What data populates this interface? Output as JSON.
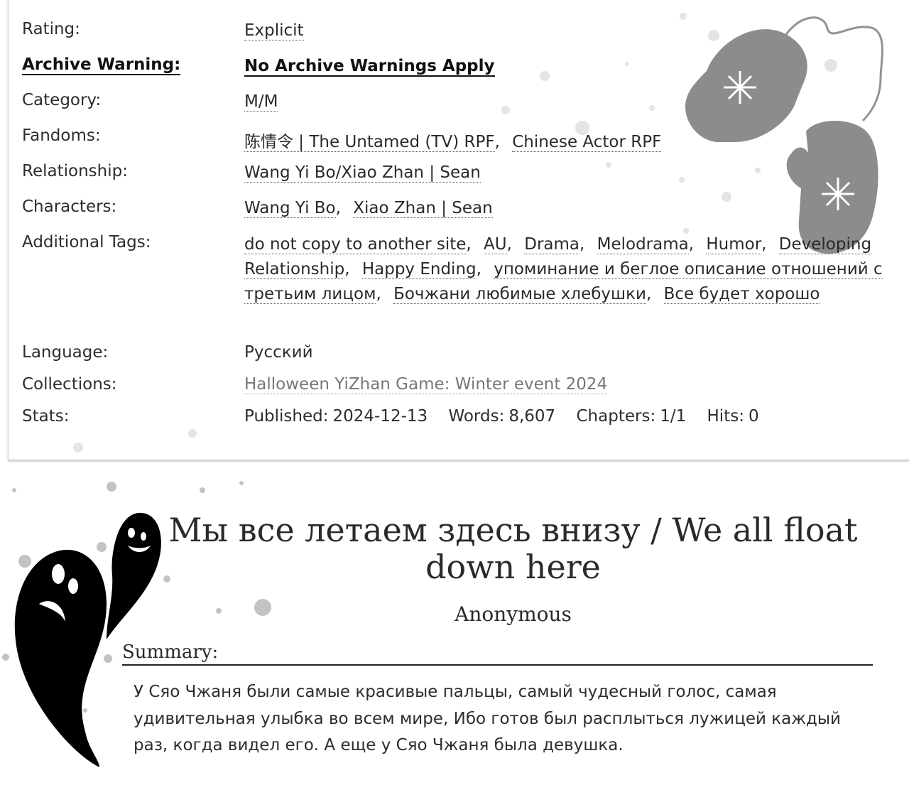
{
  "meta": {
    "rating": {
      "label": "Rating:",
      "value": "Explicit"
    },
    "warning": {
      "label": "Archive Warning:",
      "value": "No Archive Warnings Apply"
    },
    "category": {
      "label": "Category:",
      "value": "M/M"
    },
    "fandoms": {
      "label": "Fandoms:",
      "items": [
        "陈情令 | The Untamed (TV) RPF",
        "Chinese Actor RPF"
      ]
    },
    "relationship": {
      "label": "Relationship:",
      "value": "Wang Yi Bo/Xiao Zhan | Sean"
    },
    "characters": {
      "label": "Characters:",
      "items": [
        "Wang Yi Bo",
        "Xiao Zhan | Sean"
      ]
    },
    "additional_tags": {
      "label": "Additional Tags:",
      "items": [
        "do not copy to another site",
        "AU",
        "Drama",
        "Melodrama",
        "Humor",
        "Developing Relationship",
        "Happy Ending",
        "упоминание и беглое описание отношений с третьим лицом",
        "Бочжани любимые хлебушки",
        "Все будет хорошо"
      ]
    },
    "language": {
      "label": "Language:",
      "value": "Русский"
    },
    "collections": {
      "label": "Collections:",
      "value": "Halloween YiZhan Game: Winter event 2024"
    },
    "stats": {
      "label": "Stats:",
      "published_label": "Published:",
      "published": "2024-12-13",
      "words_label": "Words:",
      "words": "8,607",
      "chapters_label": "Chapters:",
      "chapters": "1/1",
      "hits_label": "Hits:",
      "hits": "0"
    }
  },
  "work": {
    "title": "Мы все летаем здесь внизу / We all float down here",
    "author": "Anonymous",
    "summary_heading": "Summary:",
    "summary": "У Сяо Чжаня были самые красивые пальцы, самый чудесный голос, самая удивительная улыбка во всем мире, Ибо готов был расплыться лужицей каждый раз, когда видел его. А еще у Сяо Чжаня была девушка."
  },
  "decor": [
    "mittens-icon",
    "ghost-icon",
    "snowflake-icon"
  ]
}
